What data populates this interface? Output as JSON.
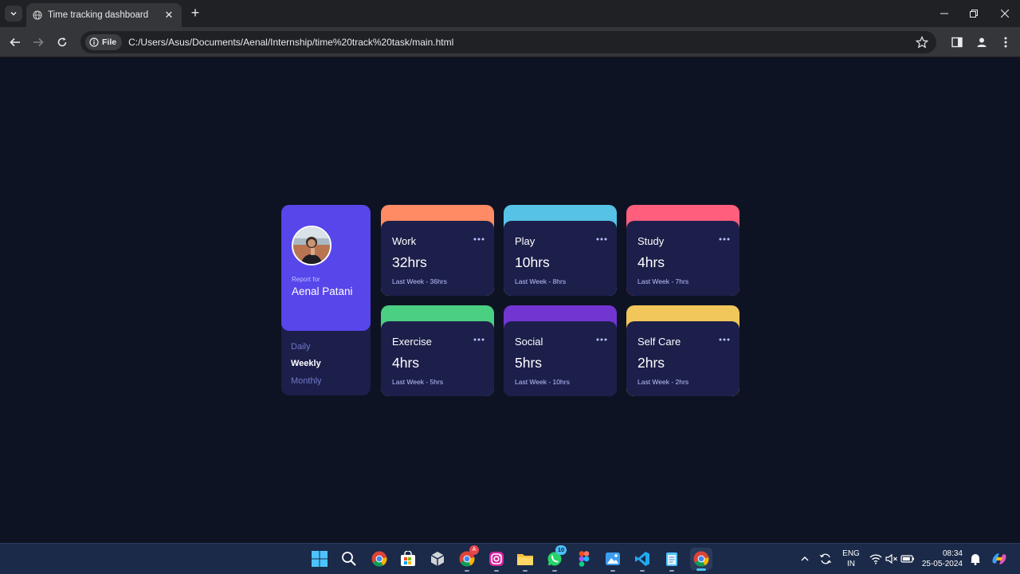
{
  "browser": {
    "tab_title": "Time tracking dashboard",
    "new_tab_symbol": "+",
    "close_symbol": "✕",
    "address_chip": "File",
    "url": "C:/Users/Asus/Documents/Aenal/Internship/time%20track%20task/main.html"
  },
  "profile": {
    "report_for": "Report for",
    "name": "Aenal Patani"
  },
  "periods": [
    {
      "label": "Daily",
      "active": false
    },
    {
      "label": "Weekly",
      "active": true
    },
    {
      "label": "Monthly",
      "active": false
    }
  ],
  "cards": [
    {
      "title": "Work",
      "hours": "32hrs",
      "last": "Last Week - 36hrs",
      "color": "#ff8b64"
    },
    {
      "title": "Play",
      "hours": "10hrs",
      "last": "Last Week - 8hrs",
      "color": "#55c2e6"
    },
    {
      "title": "Study",
      "hours": "4hrs",
      "last": "Last Week - 7hrs",
      "color": "#ff5e7d"
    },
    {
      "title": "Exercise",
      "hours": "4hrs",
      "last": "Last Week - 5hrs",
      "color": "#4bcf82"
    },
    {
      "title": "Social",
      "hours": "5hrs",
      "last": "Last Week - 10hrs",
      "color": "#7335d2"
    },
    {
      "title": "Self Care",
      "hours": "2hrs",
      "last": "Last Week - 2hrs",
      "color": "#f1c75b"
    }
  ],
  "taskbar": {
    "whatsapp_badge": "10",
    "chrome_badge": "A",
    "lang_line1": "ENG",
    "lang_line2": "IN",
    "time": "08:34",
    "date": "25-05-2024"
  },
  "colors": {
    "page_bg": "#0e1323",
    "profile_accent": "#5746ea",
    "card_bg": "#1c1f4a",
    "muted_text": "#bdc1ff"
  }
}
